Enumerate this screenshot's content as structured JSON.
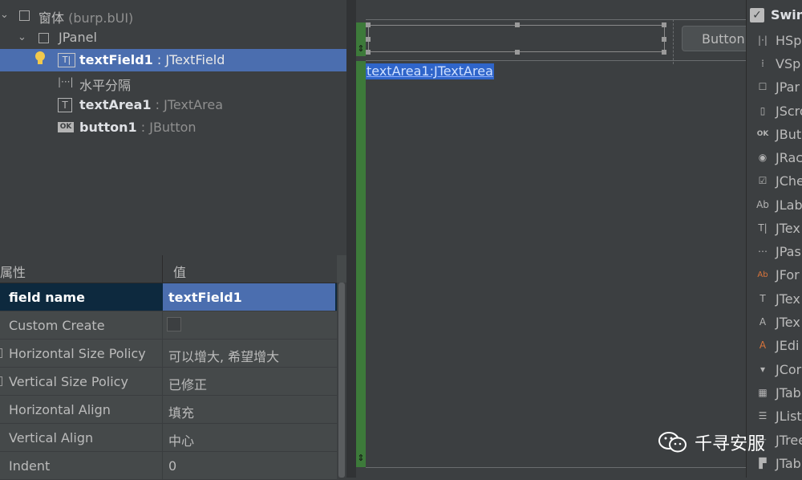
{
  "tree": {
    "rows": [
      {
        "name": "窗体",
        "type": " (burp.bUI)"
      },
      {
        "name": "JPanel",
        "type": ""
      },
      {
        "name": "textField1",
        "type": " : JTextField"
      },
      {
        "name": "水平分隔",
        "type": ""
      },
      {
        "name": "textArea1",
        "type": " : JTextArea"
      },
      {
        "name": "button1",
        "type": " : JButton"
      }
    ]
  },
  "properties": {
    "header_property": "属性",
    "header_value": "值",
    "rows": [
      {
        "key": "field name",
        "value": "textField1"
      },
      {
        "key": "Custom Create",
        "value": ""
      },
      {
        "key": "Horizontal Size Policy",
        "value": "可以增大, 希望增大"
      },
      {
        "key": "Vertical Size Policy",
        "value": "已修正"
      },
      {
        "key": "Horizontal Align",
        "value": "填充"
      },
      {
        "key": "Vertical Align",
        "value": "中心"
      },
      {
        "key": "Indent",
        "value": "0"
      }
    ]
  },
  "canvas": {
    "textarea_label": "textArea1:JTextArea",
    "button_label": "Button"
  },
  "palette": {
    "group": "Swin",
    "items": [
      {
        "icon": "hspacer-icon",
        "label": "HSp"
      },
      {
        "icon": "vspacer-icon",
        "label": "VSp"
      },
      {
        "icon": "jpanel-icon",
        "label": "JPar"
      },
      {
        "icon": "jscrollpane-icon",
        "label": "JScro"
      },
      {
        "icon": "jbutton-icon",
        "label": "JBut"
      },
      {
        "icon": "jradiobutton-icon",
        "label": "JRac"
      },
      {
        "icon": "jcheckbox-icon",
        "label": "JChe"
      },
      {
        "icon": "jlabel-icon",
        "label": "JLab"
      },
      {
        "icon": "jtextfield-icon",
        "label": "JTex"
      },
      {
        "icon": "jpasswordfield-icon",
        "label": "JPas"
      },
      {
        "icon": "jformattedtextfield-icon",
        "label": "JFor"
      },
      {
        "icon": "jtextarea-icon",
        "label": "JTex"
      },
      {
        "icon": "jtextpane-icon",
        "label": "JTex"
      },
      {
        "icon": "jeditorpane-icon",
        "label": "JEdi"
      },
      {
        "icon": "jcombobox-icon",
        "label": "JCor"
      },
      {
        "icon": "jtable-icon",
        "label": "JTab"
      },
      {
        "icon": "jlist-icon",
        "label": "JList"
      },
      {
        "icon": "jtree-icon",
        "label": "JTree"
      },
      {
        "icon": "jtabbedpane-icon",
        "label": "JTab"
      }
    ]
  },
  "watermark": {
    "text": "千寻安服"
  },
  "colors": {
    "selection": "#4b6eaf",
    "canvas_gutter": "#3d7a3a",
    "background": "#3c3f41"
  }
}
